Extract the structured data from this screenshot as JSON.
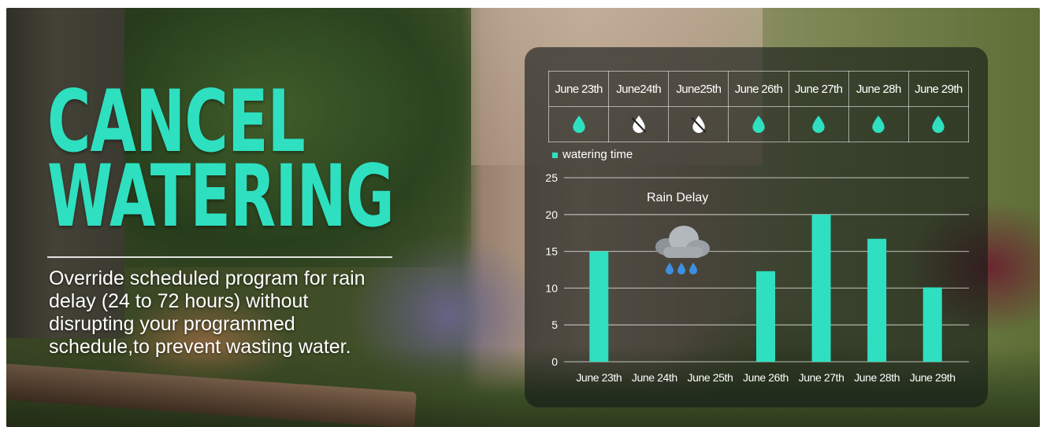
{
  "headline": {
    "line1": "CANCEL",
    "line2": "WATERING"
  },
  "description": "Override scheduled program for rain delay (24 to 72 hours) without disrupting your programmed schedule,to prevent wasting water.",
  "schedule": {
    "days": [
      {
        "label": "June 23th",
        "status": "water"
      },
      {
        "label": "June24th",
        "status": "skip"
      },
      {
        "label": "June25th",
        "status": "skip"
      },
      {
        "label": "June 26th",
        "status": "water"
      },
      {
        "label": "June 27th",
        "status": "water"
      },
      {
        "label": "June 28h",
        "status": "water"
      },
      {
        "label": "June 29th",
        "status": "water"
      }
    ],
    "icons": {
      "water": "water-drop-icon",
      "skip": "no-water-drop-icon"
    }
  },
  "rain_delay_label": "Rain Delay",
  "rain_icon": "rain-cloud-icon",
  "colors": {
    "accent": "#2ee0c0",
    "text": "#ffffff",
    "panel": "rgba(18,24,22,0.62)"
  },
  "chart_data": {
    "type": "bar",
    "title": "",
    "legend": [
      "watering time"
    ],
    "legend_position": "top-left",
    "categories": [
      "June 23th",
      "June 24th",
      "June 25th",
      "June 26th",
      "June 27th",
      "June 28th",
      "June 29th"
    ],
    "series": [
      {
        "name": "watering time",
        "values": [
          15,
          0,
          0,
          12.3,
          20,
          16.7,
          10.1
        ]
      }
    ],
    "yticks": [
      0,
      5,
      10,
      15,
      20,
      25
    ],
    "ylim": [
      0,
      25
    ],
    "grid": true,
    "xlabel": "",
    "ylabel": ""
  }
}
